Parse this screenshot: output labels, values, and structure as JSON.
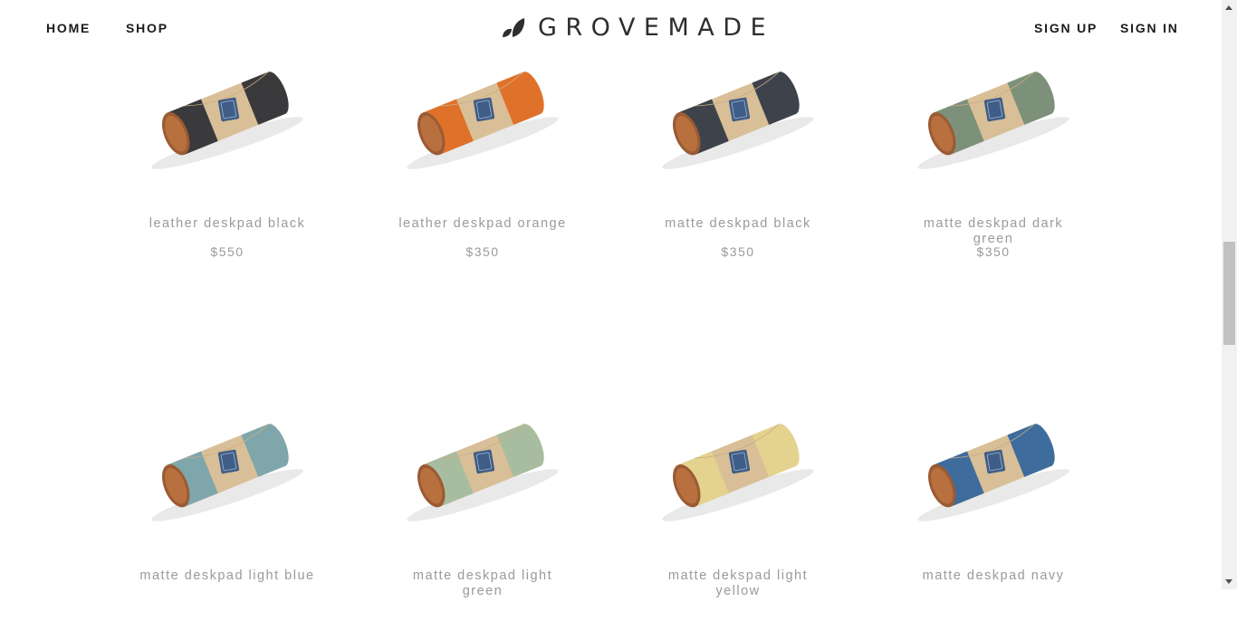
{
  "nav": {
    "home": "HOME",
    "shop": "SHOP",
    "sign_up": "SIGN UP",
    "sign_in": "SIGN IN"
  },
  "brand": {
    "name": "GROVEMADE"
  },
  "products": [
    {
      "name": "leather deskpad black",
      "price": "$550",
      "color": "#3a3a3c"
    },
    {
      "name": "leather deskpad orange",
      "price": "$350",
      "color": "#e0712a"
    },
    {
      "name": "matte deskpad black",
      "price": "$350",
      "color": "#3d424b"
    },
    {
      "name": "matte deskpad dark green",
      "price": "$350",
      "color": "#7d917a"
    },
    {
      "name": "matte deskpad light blue",
      "price": "",
      "color": "#7fa6ab"
    },
    {
      "name": "matte deskpad light green",
      "price": "",
      "color": "#a8bd9f"
    },
    {
      "name": "matte dekspad light yellow",
      "price": "",
      "color": "#e4d28f"
    },
    {
      "name": "matte deskpad navy",
      "price": "",
      "color": "#3e6c9c"
    }
  ]
}
